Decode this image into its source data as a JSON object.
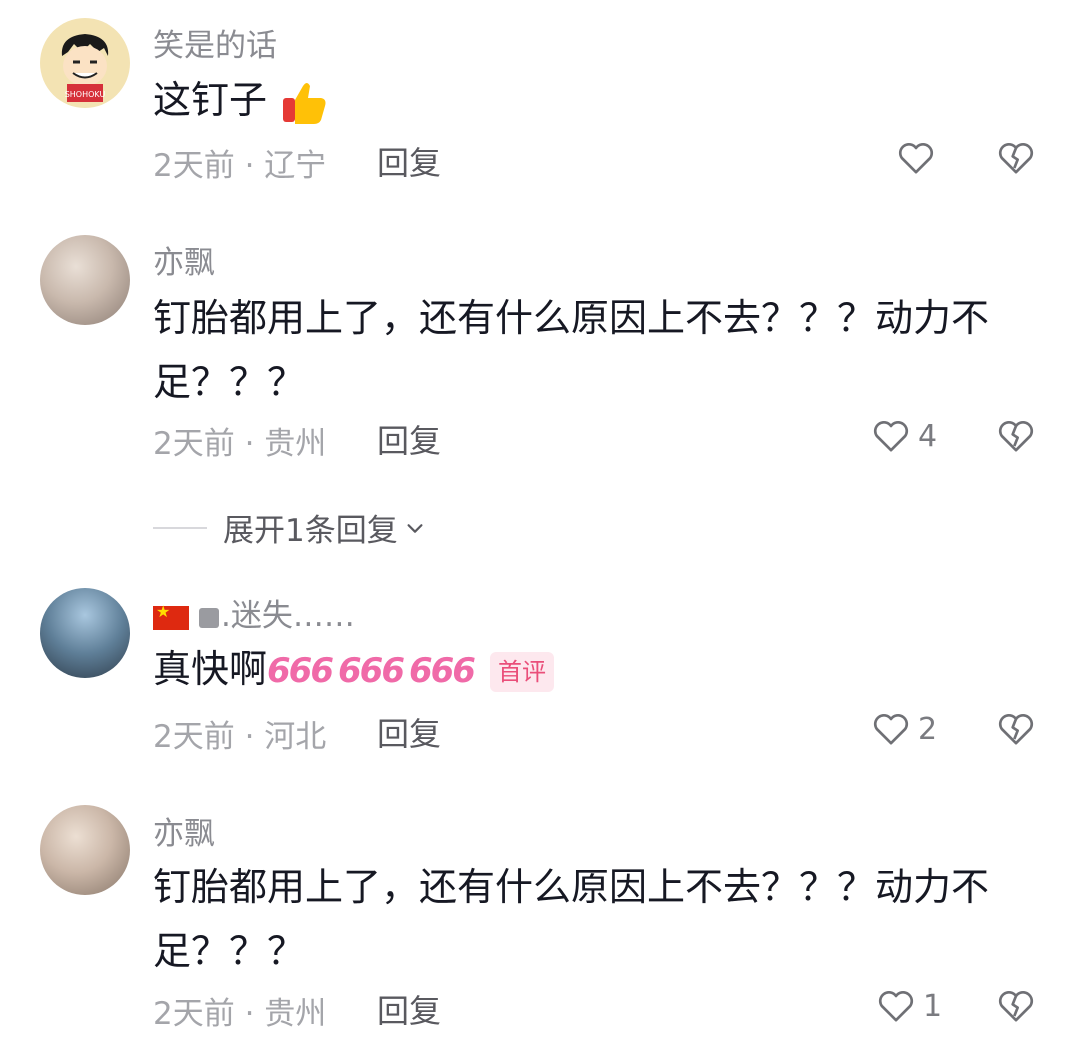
{
  "comments": [
    {
      "username": "笑是的话",
      "text": "这钉子",
      "time_location": "2天前 · 辽宁",
      "reply_label": "回复",
      "likes": "",
      "emoji": "thumbs-up-emoji"
    },
    {
      "username": "亦飘",
      "text": "钉胎都用上了，还有什么原因上不去？？？动力不足？？？",
      "time_location": "2天前 · 贵州",
      "reply_label": "回复",
      "likes": "4"
    },
    {
      "username": ".迷失……",
      "username_prefix_icon": "china-flag-icon",
      "text": "真快啊",
      "text_emoji": "666",
      "badge": "首评",
      "time_location": "2天前 · 河北",
      "reply_label": "回复",
      "likes": "2"
    },
    {
      "username": "亦飘",
      "text": "钉胎都用上了，还有什么原因上不去？？？动力不足？？？",
      "time_location": "2天前 · 贵州",
      "reply_label": "回复",
      "likes": "1"
    }
  ],
  "expand_replies_label": "展开1条回复",
  "colors": {
    "text": "#161823",
    "secondary": "#8a8b91",
    "badge": "#ea4f7a"
  }
}
